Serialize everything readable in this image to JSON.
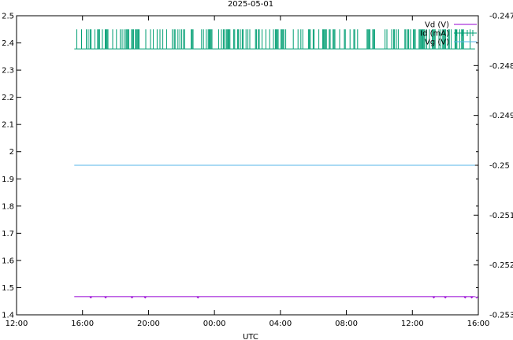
{
  "chart_data": {
    "type": "line",
    "title": "2025-05-01",
    "xlabel": "UTC",
    "x_unit": "hours (UTC) from 2025-05-01 12:00",
    "xlim": [
      0,
      28
    ],
    "x_ticks": [
      {
        "v": 0,
        "label": "12:00"
      },
      {
        "v": 4,
        "label": "16:00"
      },
      {
        "v": 8,
        "label": "20:00"
      },
      {
        "v": 12,
        "label": "00:00"
      },
      {
        "v": 16,
        "label": "04:00"
      },
      {
        "v": 20,
        "label": "08:00"
      },
      {
        "v": 24,
        "label": "12:00"
      },
      {
        "v": 28,
        "label": "16:00"
      }
    ],
    "y_left": {
      "range": [
        1.4,
        2.5
      ],
      "ticks": [
        {
          "v": 1.4,
          "label": "1.4"
        },
        {
          "v": 1.5,
          "label": "1.5"
        },
        {
          "v": 1.6,
          "label": "1.6"
        },
        {
          "v": 1.7,
          "label": "1.7"
        },
        {
          "v": 1.8,
          "label": "1.8"
        },
        {
          "v": 1.9,
          "label": "1.9"
        },
        {
          "v": 2.0,
          "label": "2"
        },
        {
          "v": 2.1,
          "label": "2.1"
        },
        {
          "v": 2.2,
          "label": "2.2"
        },
        {
          "v": 2.3,
          "label": "2.3"
        },
        {
          "v": 2.4,
          "label": "2.4"
        },
        {
          "v": 2.5,
          "label": "2.5"
        }
      ]
    },
    "y_right": {
      "range": [
        -0.253,
        -0.247
      ],
      "ticks": [
        {
          "v": -0.253,
          "label": "-0.253"
        },
        {
          "v": -0.252,
          "label": "-0.252"
        },
        {
          "v": -0.251,
          "label": "-0.251"
        },
        {
          "v": -0.25,
          "label": "-0.25"
        },
        {
          "v": -0.249,
          "label": "-0.249"
        },
        {
          "v": -0.248,
          "label": "-0.248"
        },
        {
          "v": -0.247,
          "label": "-0.247"
        }
      ]
    },
    "legend_position": "top-right",
    "series": [
      {
        "name": "Vd (V)",
        "axis": "left",
        "color": "#9400d3",
        "style": "line",
        "x_range": [
          3.5,
          27.8
        ],
        "base": 1.467,
        "dips": [
          4.5,
          5.4,
          7.0,
          7.8,
          11.0,
          25.3,
          26.0,
          27.2,
          27.6,
          27.9
        ],
        "dip_value": 1.462
      },
      {
        "name": "Id (mA)",
        "axis": "left",
        "color": "#009e73",
        "style": "impulses",
        "x_range": [
          3.5,
          27.8
        ],
        "base": 2.378,
        "high": 2.45
      },
      {
        "name": "Vg (V)",
        "axis": "right",
        "color": "#56b4e9",
        "style": "line",
        "x_range": [
          3.5,
          27.8
        ],
        "value": -0.25
      }
    ],
    "grid": false
  }
}
